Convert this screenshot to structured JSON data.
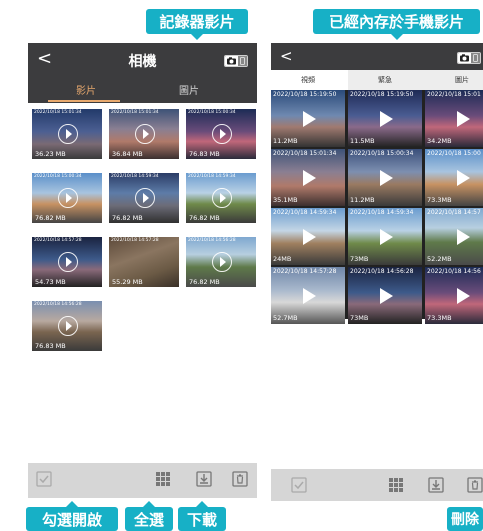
{
  "callouts": {
    "recorder_videos": "記錄器影片",
    "phone_videos": "已經內存於手機影片",
    "select_enable": "勾選開啟",
    "select_all": "全選",
    "download": "下載",
    "delete": "刪除"
  },
  "left_app": {
    "back": "<",
    "title": "相機",
    "tabs": [
      "影片",
      "圖片"
    ],
    "videos": [
      {
        "time": "2022/10/18 15:01:34",
        "size": "36.23 MB"
      },
      {
        "time": "2022/10/18 15:01:34",
        "size": "36.84 MB"
      },
      {
        "time": "2022/10/18 15:00:34",
        "size": "76.83 MB"
      },
      {
        "time": "2022/10/18 15:00:34",
        "size": "76.82 MB"
      },
      {
        "time": "2022/10/18 14:59:34",
        "size": "76.82 MB"
      },
      {
        "time": "2022/10/18 14:59:34",
        "size": "76.82 MB"
      },
      {
        "time": "2022/10/18 14:57:28",
        "size": "54.73 MB"
      },
      {
        "time": "2022/10/18 14:57:28",
        "size": "55.29 MB"
      },
      {
        "time": "2022/10/18 14:56:28",
        "size": "76.82 MB"
      },
      {
        "time": "2022/10/18 14:56:28",
        "size": "76.83 MB"
      }
    ]
  },
  "right_app": {
    "back": "<",
    "tabs": [
      "視頻",
      "緊急",
      "圖片"
    ],
    "videos": [
      {
        "time": "2022/10/18 15:19:50",
        "size": "11.2MB"
      },
      {
        "time": "2022/10/18 15:19:50",
        "size": "11.5MB"
      },
      {
        "time": "2022/10/18 15:01",
        "size": "34.2MB"
      },
      {
        "time": "2022/10/18 15:01:34",
        "size": "35.1MB"
      },
      {
        "time": "2022/10/18 15:00:34",
        "size": "11.2MB"
      },
      {
        "time": "2022/10/18 15:00",
        "size": "73.3MB"
      },
      {
        "time": "2022/10/18 14:59:34",
        "size": "24MB"
      },
      {
        "time": "2022/10/18 14:59:34",
        "size": "73MB"
      },
      {
        "time": "2022/10/18 14:57",
        "size": "52.2MB"
      },
      {
        "time": "2022/10/18 14:57:28",
        "size": "52.7MB"
      },
      {
        "time": "2022/10/18 14:56:28",
        "size": "73MB"
      },
      {
        "time": "2022/10/18 14:56",
        "size": "73.3MB"
      }
    ]
  },
  "icons": {
    "checkbox": "check-icon",
    "grid": "grid-icon",
    "download": "download-icon",
    "delete": "trash-icon",
    "camera": "camera-icon",
    "phone": "phone-icon"
  },
  "colors": {
    "callout": "#17b0c6",
    "header": "#3c3c3e",
    "tab_active": "#e8a96e",
    "toolbar": "#d6d6d6"
  }
}
